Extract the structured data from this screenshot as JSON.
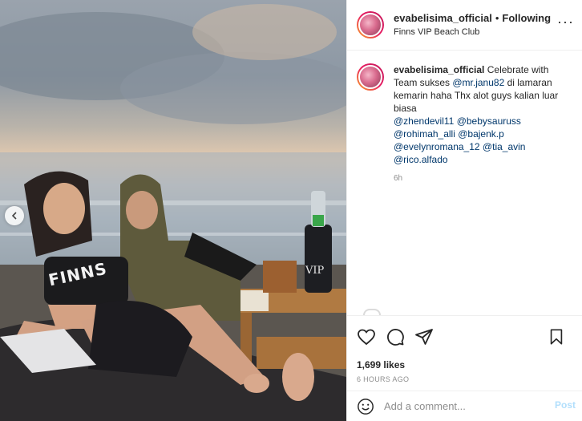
{
  "post": {
    "username": "evabelisima_official",
    "separator": "•",
    "follow_status": "Following",
    "location": "Finns VIP Beach Club",
    "more_label": "···"
  },
  "caption": {
    "username": "evabelisima_official",
    "text_1": " Celebrate with Team sukses ",
    "mention_1": "@mr.janu82",
    "text_2": " di lamaran kemarin haha Thx alot guys kalian luar biasa",
    "mentions": [
      "@zhendevil11",
      "@bebysauruss",
      "@rohimah_alli",
      "@bajenk.p",
      "@evelynromana_12",
      "@tia_avin",
      "@rico.alfado"
    ],
    "time": "6h"
  },
  "stats": {
    "likes": "1,699 likes",
    "posted": "6 HOURS AGO"
  },
  "comment_box": {
    "placeholder": "Add a comment...",
    "post_label": "Post"
  },
  "photo": {
    "shirt_text": "FINNS",
    "bottle_text": "VIP"
  },
  "icons": {
    "like": "heart-icon",
    "comment": "comment-icon",
    "share": "paper-plane-icon",
    "save": "bookmark-icon",
    "emoji": "smiley-icon",
    "prev": "chevron-left-icon"
  },
  "colors": {
    "link": "#00376b",
    "muted": "#8e8e8e",
    "post_disabled": "#b2dffc"
  }
}
